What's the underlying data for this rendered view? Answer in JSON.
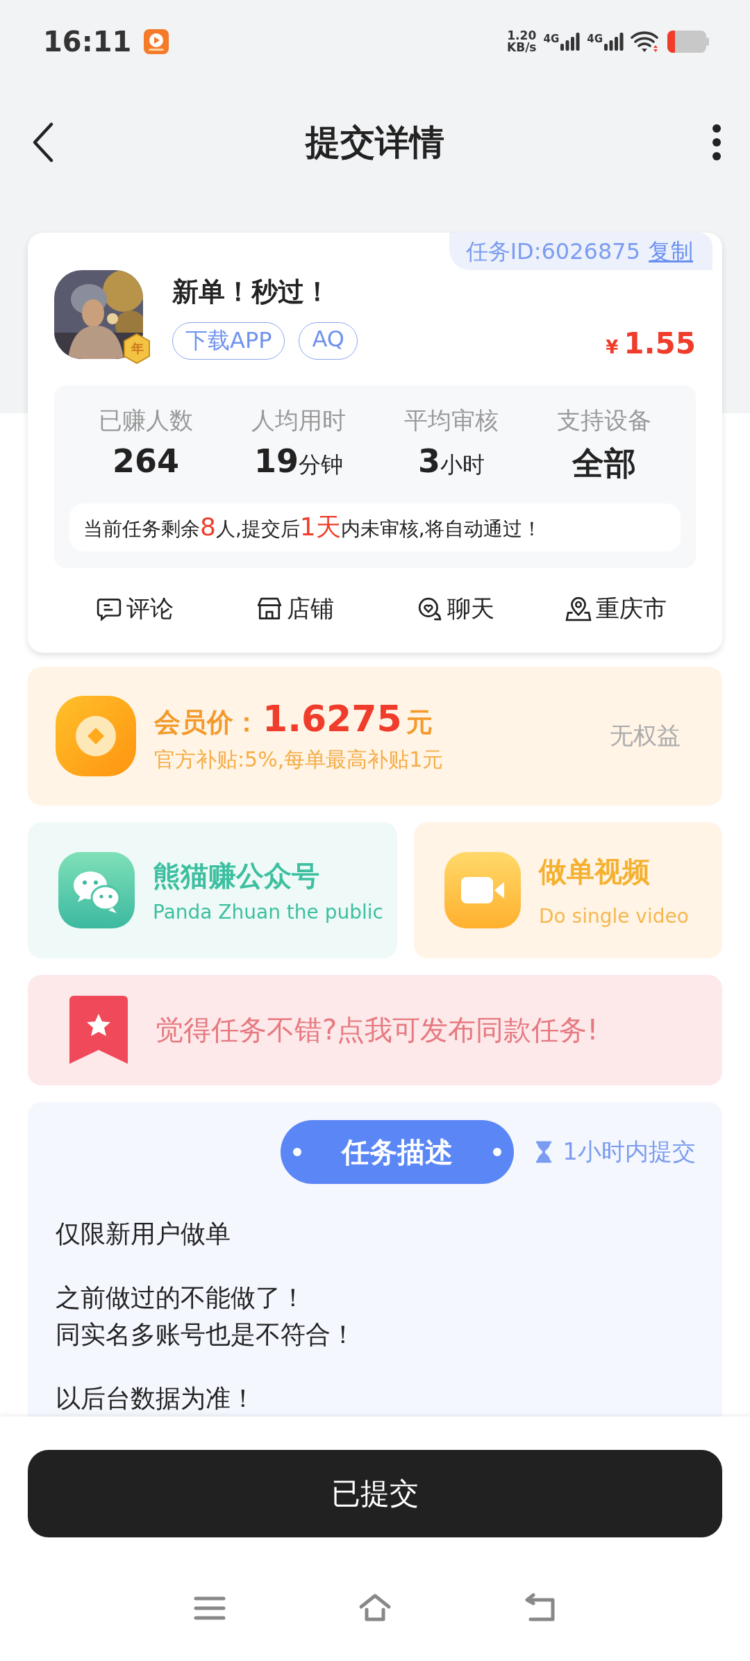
{
  "status_bar": {
    "time": "16:11",
    "speed": "1.20",
    "speed_unit": "KB/s",
    "networks": [
      "4G",
      "4G"
    ]
  },
  "header": {
    "title": "提交详情"
  },
  "task": {
    "id_label": "任务ID:6026875",
    "copy": "复制",
    "title": "新单！秒过！",
    "badge": "年",
    "tags": [
      "下载APP",
      "AQ"
    ],
    "currency": "¥",
    "price": "1.55",
    "stats": [
      {
        "label": "已赚人数",
        "value": "264"
      },
      {
        "label": "人均用时",
        "value": "19",
        "unit": "分钟"
      },
      {
        "label": "平均审核",
        "value": "3",
        "unit": "小时"
      },
      {
        "label": "支持设备",
        "value": "全部"
      }
    ],
    "notice": [
      {
        "text": "当前任务剩余",
        "highlight": false
      },
      {
        "text": "8",
        "highlight": true
      },
      {
        "text": "人,提交后",
        "highlight": false
      },
      {
        "text": "1天",
        "highlight": true
      },
      {
        "text": "内未审核,将自动通过！",
        "highlight": false
      }
    ],
    "actions": [
      {
        "kind": "comment",
        "label": "评论"
      },
      {
        "kind": "shop",
        "label": "店铺"
      },
      {
        "kind": "chat",
        "label": "聊天"
      },
      {
        "kind": "location",
        "label": "重庆市"
      }
    ]
  },
  "member": {
    "label": "会员价：",
    "price": "1.6275",
    "unit": "元",
    "subsidy": "官方补贴:5%,每单最高补贴1元",
    "benefit": "无权益"
  },
  "promos": [
    {
      "kind": "wechat",
      "title": "熊猫赚公众号",
      "subtitle": "Panda Zhuan the public"
    },
    {
      "kind": "video",
      "title": "做单视频",
      "subtitle": "Do single video"
    }
  ],
  "publish_banner": {
    "text": "觉得任务不错?点我可发布同款任务!"
  },
  "description": {
    "title": "任务描述",
    "deadline": "1小时内提交",
    "paragraphs": [
      [
        "仅限新用户做单"
      ],
      [
        "之前做过的不能做了！",
        "同实名多账号也是不符合！"
      ],
      [
        "以后台数据为准！"
      ]
    ]
  },
  "submit_button": {
    "label": "已提交"
  }
}
